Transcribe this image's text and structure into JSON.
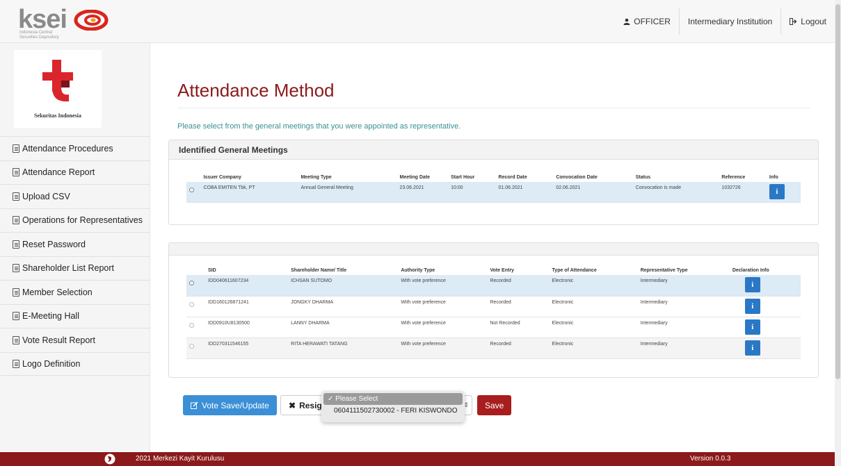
{
  "header": {
    "logo_text": "ksei",
    "logo_sub1": "Indonesia Central",
    "logo_sub2": "Securities Depository",
    "user": "OFFICER",
    "institution": "Intermediary Institution",
    "logout": "Logout"
  },
  "sidebar": {
    "org_name": "Sekuritas Indonesia",
    "items": [
      {
        "label": "Attendance Procedures"
      },
      {
        "label": "Attendance Report"
      },
      {
        "label": "Upload CSV"
      },
      {
        "label": "Operations for Representatives"
      },
      {
        "label": "Reset Password"
      },
      {
        "label": "Shareholder List Report"
      },
      {
        "label": "Member Selection"
      },
      {
        "label": "E-Meeting Hall"
      },
      {
        "label": "Vote Result Report"
      },
      {
        "label": "Logo Definition"
      }
    ]
  },
  "main": {
    "title": "Attendance Method",
    "subtitle": "Please select from the general meetings that you were appointed as representative.",
    "meetings_panel": {
      "title": "Identified General Meetings",
      "columns": [
        "Issuer Company",
        "Meeting Type",
        "Meeting Date",
        "Start Hour",
        "Record Date",
        "Convocation Date",
        "Status",
        "Reference",
        "Info"
      ],
      "rows": [
        {
          "issuer": "COBA EMITEN Tbk, PT",
          "type": "Annual General Meeting",
          "date": "23.06.2021",
          "hour": "10:00",
          "record": "01.06.2021",
          "convocation": "02.06.2021",
          "status": "Convocation is made",
          "reference": "1032726",
          "info": "i"
        }
      ]
    },
    "shareholders_panel": {
      "columns": [
        "SID",
        "Shareholder Name/ Title",
        "Authority Type",
        "Vote Entry",
        "Type of Attendance",
        "Representative Type",
        "Declaration Info"
      ],
      "rows": [
        {
          "sid": "IDD040611607234",
          "name": "ICHSAN SUTOMO",
          "authority": "With vote preference",
          "vote": "Recorded",
          "attendance": "Electronic",
          "rep": "Intermediary",
          "info": "i"
        },
        {
          "sid": "IDD160126871241",
          "name": "JONGKY DHARMA",
          "authority": "With vote preference",
          "vote": "Recorded",
          "attendance": "Electronic",
          "rep": "Intermediary",
          "info": "i"
        },
        {
          "sid": "IDD0910U8130500",
          "name": "LANNY DHARMA",
          "authority": "With vote preference",
          "vote": "Not Recorded",
          "attendance": "Electronic",
          "rep": "Intermediary",
          "info": "i"
        },
        {
          "sid": "IDD270311546155",
          "name": "RITA HERAWATI TATANG",
          "authority": "With vote preference",
          "vote": "Recorded",
          "attendance": "Electronic",
          "rep": "Intermediary",
          "info": "i"
        }
      ]
    },
    "buttons": {
      "vote_save": "Vote Save/Update",
      "resign": "Resign",
      "save": "Save"
    },
    "dropdown": {
      "options": [
        "Please Select",
        "0604111502730002 - FERI KISWONDO"
      ],
      "selected": "Please Select"
    }
  },
  "footer": {
    "text": "2021 Merkezi Kayit Kurulusu",
    "version": "Version 0.0.3"
  },
  "colors": {
    "brand_red": "#8b1a1a",
    "accent_blue": "#2a78c5",
    "selected_row": "#dcebf5"
  }
}
